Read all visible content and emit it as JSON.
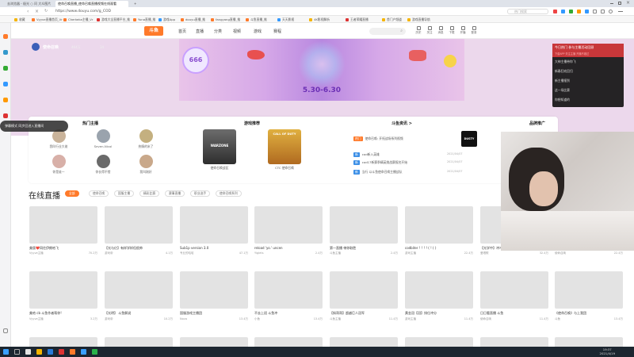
{
  "browser": {
    "tabs": [
      {
        "label": "去浏览器 - 极光 ○ 问 大众图片",
        "active": false
      },
      {
        "label": "使命召唤直播_使命召唤直播视频在线观看",
        "active": true
      },
      {
        "label": "+",
        "active": false
      }
    ],
    "url": "https://www.douyu.com/g_COD",
    "search_placeholder": "热门搜索",
    "bookmarks": [
      "收藏",
      "Vyyve直播首页_Vr",
      "Cherkeka主播_Vr",
      "游戏大全直播平台_推",
      "Yuna直播_推",
      "游戏App",
      "douyu直播_推",
      "fangyang直播_推",
      "斗鱼直播_推",
      "天天影视",
      "4K影视解析",
      "王者荣耀直播",
      "首门户频道",
      "游戏直播导航"
    ]
  },
  "site": {
    "logo": "斗鱼",
    "nav": [
      "首页",
      "直播",
      "分类",
      "视频",
      "游戏",
      "赛程"
    ],
    "header_icons": [
      "历史",
      "关注",
      "消息",
      "下载",
      "开播",
      "登录"
    ],
    "category": {
      "name": "使命召唤",
      "count1": "464万",
      "count2": "34"
    },
    "banner_text": "5.30-6.30",
    "banner_badge": "666",
    "anchors_title": "热门主播",
    "anchors": [
      {
        "name": "我叫行业大佬"
      },
      {
        "name": "Seven-Nicol"
      },
      {
        "name": "热情的米了"
      },
      {
        "name": "你是谁一"
      },
      {
        "name": "你长得不错"
      },
      {
        "name": "我叫刚好"
      }
    ],
    "games_title": "游戏推荐",
    "games": [
      {
        "name": "使命召唤战区",
        "cover_text": "WARZONE"
      },
      {
        "name": "CTC 使命召唤",
        "cover_text": "CALL OF DUTY"
      }
    ],
    "news_title": "斗鱼资讯 >",
    "news": [
      {
        "tag": "热门",
        "text": "使命召唤: 开拓战场系列视频"
      },
      {
        "tag": "新",
        "text": "cod新入英雄"
      },
      {
        "tag": "新",
        "text": "cod17新赛季精英挑战赛报名开始"
      },
      {
        "tag": "新",
        "text": "当行 以斗鱼使命召唤主播战队"
      }
    ],
    "news_dates": [
      "2021/04/07",
      "2021/04/07",
      "2021/04/07"
    ],
    "sponsor": {
      "title": "品牌推广",
      "logo": "DUSTY"
    },
    "live_title": "在线直播",
    "filters": [
      {
        "label": "全部",
        "active": true
      },
      {
        "label": "使命召唤",
        "active": false
      },
      {
        "label": "国服主播",
        "active": false
      },
      {
        "label": "精彩比赛",
        "active": false
      },
      {
        "label": "赛事直播",
        "active": false
      },
      {
        "label": "职业选手",
        "active": false
      },
      {
        "label": "使命召唤系列",
        "active": false
      }
    ],
    "channels_row1": [
      {
        "title": "美版❤️同往伊朗哈飞",
        "anchor": "Vyyve主播",
        "viewers": "70.2万"
      },
      {
        "title": "【光与亿】有样学样但很帅",
        "anchor": "游戏帝",
        "viewers": "4.1万"
      },
      {
        "title": "Sub1p version 3.0",
        "anchor": "专业的哈哈",
        "viewers": "47.1万"
      },
      {
        "title": "reload 'yo.' uncen",
        "anchor": "Yiglets",
        "viewers": "2.4万"
      },
      {
        "title": "第一直播 带你取胜",
        "anchor": "斗鱼主播",
        "viewers": "2.4万"
      },
      {
        "title": "codbiter ! ! ! ! ( ! ( )",
        "anchor": "游戏主播",
        "viewers": "22.4万"
      },
      {
        "title": "【光学中】冲冲冲",
        "anchor": "爱唱歌",
        "viewers": "32.4万"
      },
      {
        "title": "",
        "anchor": "使命召唤",
        "viewers": "22.4万"
      }
    ],
    "channels_row2": [
      {
        "title": "美哈 cb 斗鱼作者帮你!",
        "anchor": "Vyyve主播",
        "viewers": "3.2万"
      },
      {
        "title": "【光明】 斗鱼解说",
        "anchor": "游戏帝",
        "viewers": "10.2万"
      },
      {
        "title": "国服游戏主播团",
        "anchor": "Nova",
        "viewers": "13.4万"
      },
      {
        "title": "不去上班 斗鱼冲",
        "anchor": "小鱼",
        "viewers": "13.4万"
      },
      {
        "title": "【斜哥哥】超越巨人冠军",
        "anchor": "斗鱼主播",
        "viewers": "11.4万"
      },
      {
        "title": "黄金冠【冠】排位冲分",
        "anchor": "游戏主播",
        "viewers": "11.4万"
      },
      {
        "title": "日日看直播 斗鱼",
        "anchor": "使命召唤",
        "viewers": "11.4万"
      },
      {
        "title": "《使命召唤》与上我团",
        "anchor": "斗鱼",
        "viewers": "13.4万"
      }
    ]
  },
  "popups": {
    "hot_header": "今日热门 参与主播活动回顾",
    "hot_sub": "下载APP 关注主播 开播不错过",
    "hot_items": [
      "大神主播带你飞",
      "新春狂欢回归",
      "新主播报到",
      "这一场比赛",
      "你想知道的"
    ],
    "tooltip": "弹幕模式 同步回进入直播间"
  },
  "taskbar": {
    "time": "19:37",
    "date": "2021/4/19"
  }
}
